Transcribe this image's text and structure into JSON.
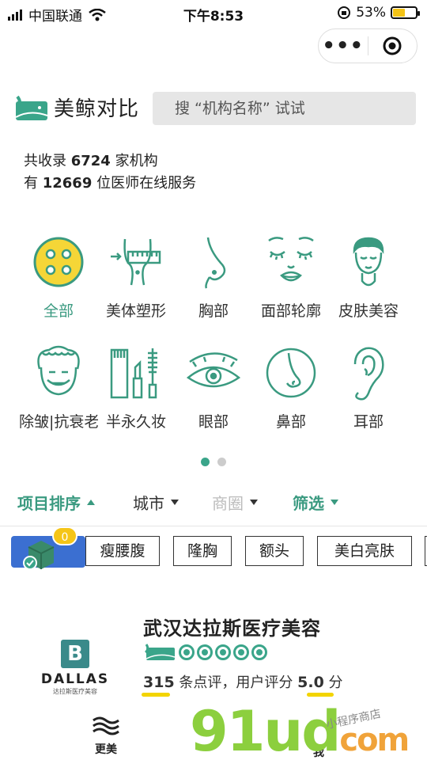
{
  "status_bar": {
    "carrier": "中国联通",
    "time": "下午8:53",
    "battery": "53%"
  },
  "app": {
    "brand_name": "美鲸对比",
    "search_placeholder": "搜 “机构名称” 试试"
  },
  "stats": {
    "line1_prefix": "共收录",
    "institutions": "6724",
    "line1_suffix": "家机构",
    "line2_prefix": "有",
    "doctors": "12669",
    "line2_suffix": "位医师在线服务"
  },
  "categories": [
    {
      "label": "全部",
      "icon": "all-icon"
    },
    {
      "label": "美体塑形",
      "icon": "body-shaping-icon"
    },
    {
      "label": "胸部",
      "icon": "chest-icon"
    },
    {
      "label": "面部轮廓",
      "icon": "face-contour-icon"
    },
    {
      "label": "皮肤美容",
      "icon": "skin-care-icon"
    },
    {
      "label": "除皱|抗衰老",
      "icon": "anti-aging-icon"
    },
    {
      "label": "半永久妆",
      "icon": "makeup-icon"
    },
    {
      "label": "眼部",
      "icon": "eye-icon"
    },
    {
      "label": "鼻部",
      "icon": "nose-icon"
    },
    {
      "label": "耳部",
      "icon": "ear-icon"
    }
  ],
  "filters": {
    "sort": "项目排序",
    "city": "城市",
    "district": "商圈",
    "filter": "筛选"
  },
  "tags": {
    "badge": "0",
    "items": [
      "瘦腰腹",
      "隆胸",
      "额头",
      "美白亮肤"
    ]
  },
  "listing": {
    "logo_letter": "B",
    "logo_text": "DALLAS",
    "logo_sub": "达拉斯医疗美容",
    "name": "武汉达拉斯医疗美容",
    "review_count": "315",
    "review_text": "条点评，用户评分",
    "score": "5.0",
    "score_unit": "分"
  },
  "tabbar": {
    "more": "更美",
    "me": "我"
  },
  "watermark": {
    "main": "91ud",
    "com": "com",
    "small": "小程序商店"
  },
  "colors": {
    "accent": "#3a9a80",
    "yellow": "#f3c316",
    "blue": "#3b6fd1"
  }
}
